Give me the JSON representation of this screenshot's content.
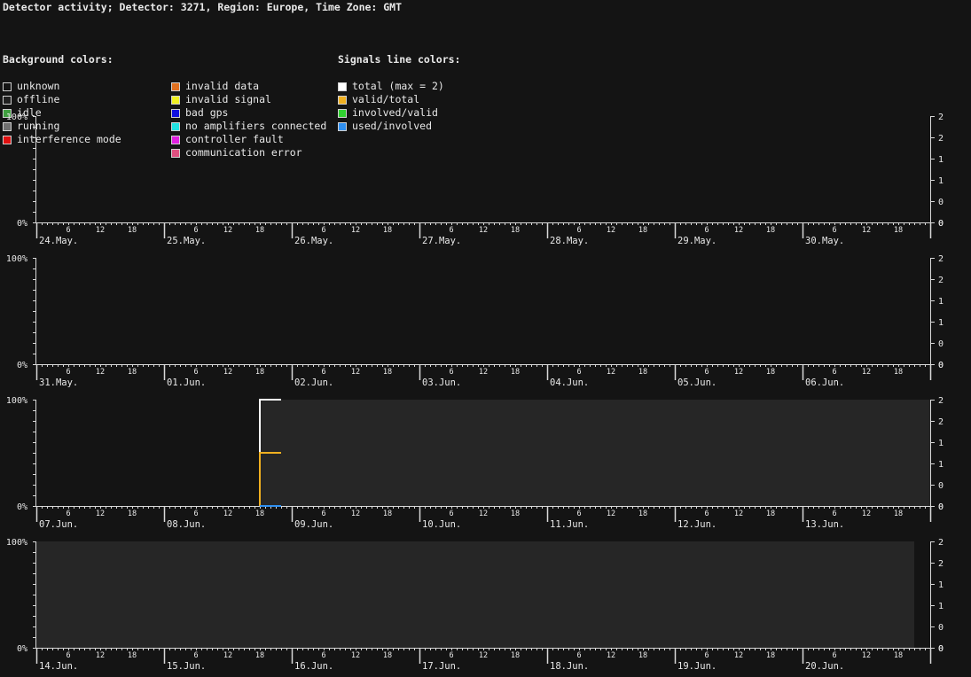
{
  "title": "Detector activity; Detector: 3271, Region: Europe, Time Zone: GMT",
  "legend": {
    "background_header": "Background colors:",
    "background": [
      {
        "label": "unknown",
        "color": "#141414"
      },
      {
        "label": "offline",
        "color": "#202020"
      },
      {
        "label": "idle",
        "color": "#40a040"
      },
      {
        "label": "running",
        "color": "#707070"
      },
      {
        "label": "interference mode",
        "color": "#e01010"
      },
      {
        "label": "invalid data",
        "color": "#e07020"
      },
      {
        "label": "invalid signal",
        "color": "#f0f020"
      },
      {
        "label": "bad gps",
        "color": "#1010e0"
      },
      {
        "label": "no amplifiers connected",
        "color": "#20e0e0"
      },
      {
        "label": "controller fault",
        "color": "#e020e0"
      },
      {
        "label": "communication error",
        "color": "#e05080"
      }
    ],
    "signals_header": "Signals line colors:",
    "signals": [
      {
        "label": "total (max = 2)",
        "color": "#ffffff"
      },
      {
        "label": "valid/total",
        "color": "#f0b020"
      },
      {
        "label": "involved/valid",
        "color": "#30d030"
      },
      {
        "label": "used/involved",
        "color": "#3090f0"
      }
    ]
  },
  "chart_data": [
    {
      "type": "line",
      "days": [
        "24.May.",
        "25.May.",
        "26.May.",
        "27.May.",
        "28.May.",
        "29.May.",
        "30.May."
      ],
      "hour_ticks": [
        "6",
        "12",
        "18"
      ],
      "left_axis": [
        "100%",
        "0%"
      ],
      "right_axis": [
        "2",
        "2",
        "1",
        "1",
        "0",
        "0"
      ],
      "right_ylim": [
        0,
        2
      ],
      "background": [],
      "series": []
    },
    {
      "type": "line",
      "days": [
        "31.May.",
        "01.Jun.",
        "02.Jun.",
        "03.Jun.",
        "04.Jun.",
        "05.Jun.",
        "06.Jun."
      ],
      "hour_ticks": [
        "6",
        "12",
        "18"
      ],
      "left_axis": [
        "100%",
        "0%"
      ],
      "right_axis": [
        "2",
        "2",
        "1",
        "1",
        "0",
        "0"
      ],
      "right_ylim": [
        0,
        2
      ],
      "background": [],
      "series": []
    },
    {
      "type": "line",
      "days": [
        "07.Jun.",
        "08.Jun.",
        "09.Jun.",
        "10.Jun.",
        "11.Jun.",
        "12.Jun.",
        "13.Jun."
      ],
      "hour_ticks": [
        "6",
        "12",
        "18"
      ],
      "left_axis": [
        "100%",
        "0%"
      ],
      "right_axis": [
        "2",
        "2",
        "1",
        "1",
        "0",
        "0"
      ],
      "right_ylim": [
        0,
        2
      ],
      "background": [
        {
          "state": "offline",
          "from_hour": 42,
          "to_hour": 168
        }
      ],
      "series": [
        {
          "name": "total (max = 2)",
          "color": "#ffffff",
          "points": [
            [
              42,
              0
            ],
            [
              42,
              2
            ],
            [
              46,
              2
            ]
          ]
        },
        {
          "name": "valid/total",
          "color": "#f0b020",
          "points": [
            [
              42,
              0
            ],
            [
              42,
              1
            ],
            [
              46,
              1
            ]
          ]
        },
        {
          "name": "used/involved",
          "color": "#3090f0",
          "points": [
            [
              42,
              0
            ],
            [
              46,
              0
            ]
          ]
        }
      ]
    },
    {
      "type": "line",
      "days": [
        "14.Jun.",
        "15.Jun.",
        "16.Jun.",
        "17.Jun.",
        "18.Jun.",
        "19.Jun.",
        "20.Jun."
      ],
      "hour_ticks": [
        "6",
        "12",
        "18"
      ],
      "left_axis": [
        "100%",
        "0%"
      ],
      "right_axis": [
        "2",
        "2",
        "1",
        "1",
        "0",
        "0"
      ],
      "right_ylim": [
        0,
        2
      ],
      "background": [
        {
          "state": "offline",
          "from_hour": 0,
          "to_hour": 165
        }
      ],
      "series": []
    }
  ]
}
